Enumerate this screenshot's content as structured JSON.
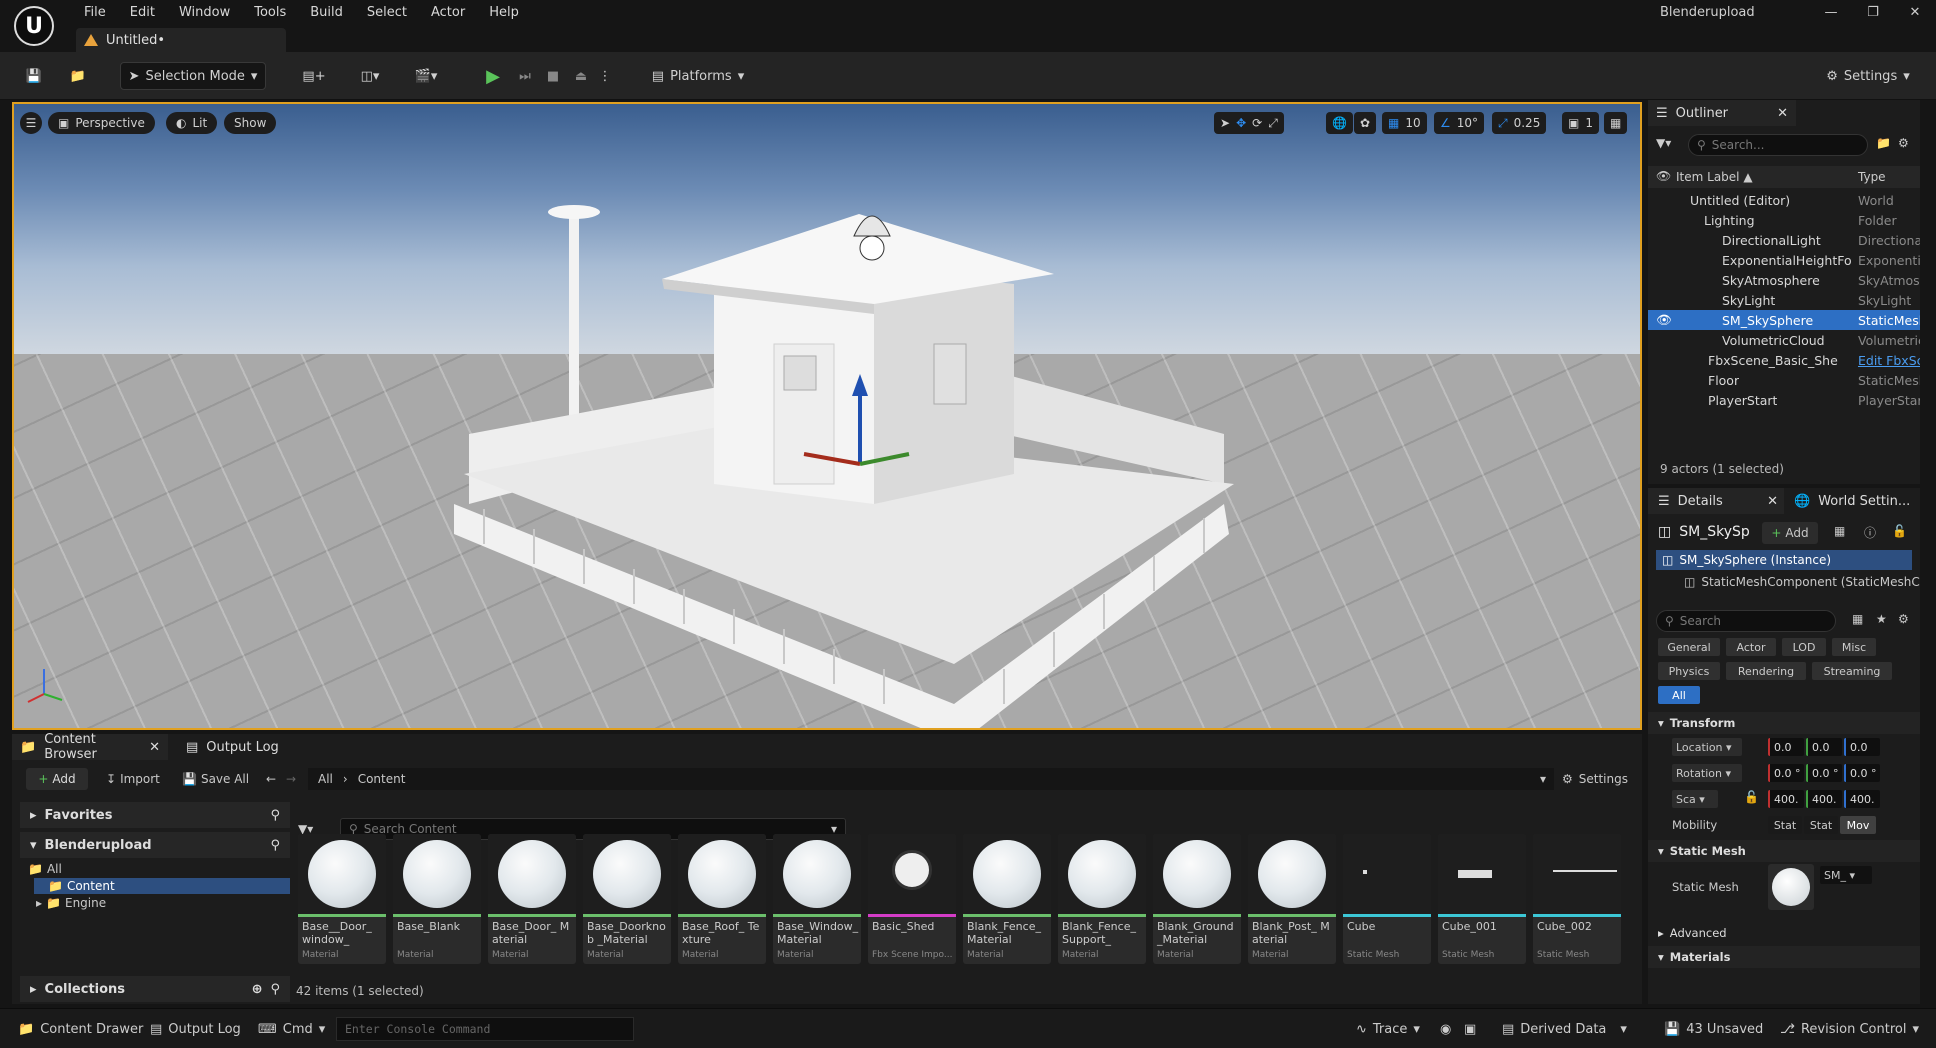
{
  "menu": [
    "File",
    "Edit",
    "Window",
    "Tools",
    "Build",
    "Select",
    "Actor",
    "Help"
  ],
  "doc_tab": "Untitled•",
  "app_name": "Blenderupload",
  "toolbar": {
    "selection_mode": "Selection Mode",
    "platforms": "Platforms",
    "settings": "Settings"
  },
  "viewport": {
    "perspective": "Perspective",
    "lit": "Lit",
    "show": "Show",
    "grid_snap": "10",
    "rot_snap": "10°",
    "scale_snap": "0.25",
    "camera_speed": "1"
  },
  "outliner": {
    "title": "Outliner",
    "search_placeholder": "Search...",
    "col_label": "Item Label ▲",
    "col_type": "Type",
    "rows": [
      {
        "label": "Untitled (Editor)",
        "type": "World"
      },
      {
        "label": "Lighting",
        "type": "Folder"
      },
      {
        "label": "DirectionalLight",
        "type": "DirectionalL"
      },
      {
        "label": "ExponentialHeightFo",
        "type": "Exponentia"
      },
      {
        "label": "SkyAtmosphere",
        "type": "SkyAtmosp"
      },
      {
        "label": "SkyLight",
        "type": "SkyLight"
      },
      {
        "label": "SM_SkySphere",
        "type": "StaticMesh"
      },
      {
        "label": "VolumetricCloud",
        "type": "Volumetric"
      },
      {
        "label": "FbxScene_Basic_She",
        "type": "Edit FbxSc"
      },
      {
        "label": "Floor",
        "type": "StaticMesh"
      },
      {
        "label": "PlayerStart",
        "type": "PlayerStart"
      }
    ],
    "status": "9 actors (1 selected)"
  },
  "details": {
    "tab": "Details",
    "world_tab": "World Settin...",
    "object_name": "SM_SkySp",
    "add": "Add",
    "instance": "SM_SkySphere (Instance)",
    "component": "StaticMeshComponent (StaticMeshC",
    "search_placeholder": "Search",
    "filters": [
      "General",
      "Actor",
      "LOD",
      "Misc",
      "Physics",
      "Rendering",
      "Streaming",
      "All"
    ],
    "transform": "Transform",
    "location": "Location",
    "rotation": "Rotation",
    "scale": "Sca",
    "loc_vals": [
      "0.0",
      "0.0",
      "0.0"
    ],
    "rot_vals": [
      "0.0 °",
      "0.0 °",
      "0.0 °"
    ],
    "scale_vals": [
      "400.",
      "400.",
      "400."
    ],
    "mobility": "Mobility",
    "mobility_opts": [
      "Stat",
      "Stat",
      "Mov"
    ],
    "static_mesh_sec": "Static Mesh",
    "static_mesh_lbl": "Static Mesh",
    "static_mesh_val": "SM_",
    "advanced": "Advanced",
    "materials": "Materials"
  },
  "content_browser": {
    "tab": "Content Browser",
    "output_tab": "Output Log",
    "add": "Add",
    "import": "Import",
    "save_all": "Save All",
    "crumb_all": "All",
    "crumb_content": "Content",
    "settings": "Settings",
    "favorites": "Favorites",
    "project": "Blenderupload",
    "tree": [
      "All",
      "Content",
      "Engine"
    ],
    "collections": "Collections",
    "search_placeholder": "Search Content",
    "status": "42 items (1 selected)",
    "assets": [
      {
        "name": "Base__Door_ window_",
        "kind": "Material",
        "type": "mat"
      },
      {
        "name": "Base_Blank",
        "kind": "Material",
        "type": "mat"
      },
      {
        "name": "Base_Door_ Material",
        "kind": "Material",
        "type": "mat"
      },
      {
        "name": "Base_Doorknob _Material",
        "kind": "Material",
        "type": "mat"
      },
      {
        "name": "Base_Roof_ Texture",
        "kind": "Material",
        "type": "mat"
      },
      {
        "name": "Base_Window_ Material",
        "kind": "Material",
        "type": "mat"
      },
      {
        "name": "Basic_Shed",
        "kind": "Fbx Scene Impo...",
        "type": "fbx"
      },
      {
        "name": "Blank_Fence_ Material",
        "kind": "Material",
        "type": "mat"
      },
      {
        "name": "Blank_Fence_ Support_",
        "kind": "Material",
        "type": "mat"
      },
      {
        "name": "Blank_Ground _Material",
        "kind": "Material",
        "type": "mat"
      },
      {
        "name": "Blank_Post_ Material",
        "kind": "Material",
        "type": "mat"
      },
      {
        "name": "Cube",
        "kind": "Static Mesh",
        "type": "mesh"
      },
      {
        "name": "Cube_001",
        "kind": "Static Mesh",
        "type": "mesh"
      },
      {
        "name": "Cube_002",
        "kind": "Static Mesh",
        "type": "mesh"
      }
    ]
  },
  "statusbar": {
    "content_drawer": "Content Drawer",
    "output_log": "Output Log",
    "cmd": "Cmd",
    "console_placeholder": "Enter Console Command",
    "trace": "Trace",
    "derived_data": "Derived Data",
    "unsaved": "43 Unsaved",
    "revision": "Revision Control"
  },
  "colors": {
    "accent": "#2d6fc4",
    "viewport_border": "#e0a020",
    "material_bar": "#6bbf6b",
    "mesh_bar": "#3cc7d6",
    "fbx_bar": "#d43cc7"
  }
}
